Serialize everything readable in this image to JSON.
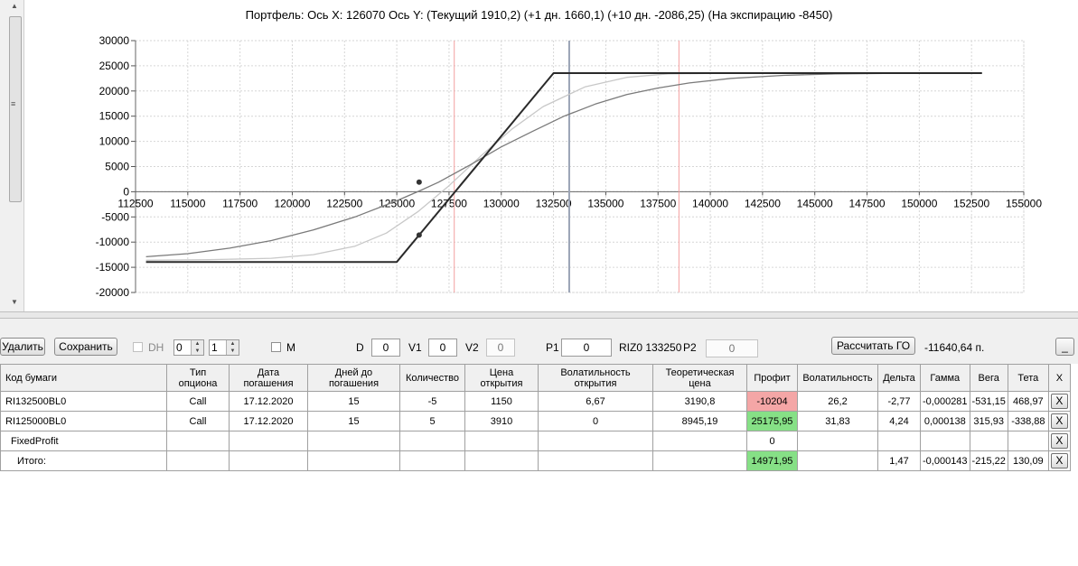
{
  "chart": {
    "title": "Портфель: Ось X:  126070 Ось Y:   (Текущий 1910,2)  (+1 дн. 1660,1)  (+10 дн. -2086,25)  (На экспирацию -8450)"
  },
  "chart_data": {
    "type": "line",
    "xlim": [
      112500,
      155000
    ],
    "ylim": [
      -20000,
      30000
    ],
    "x_ticks": [
      "112500",
      "115000",
      "117500",
      "120000",
      "122500",
      "125000",
      "127500",
      "130000",
      "132500",
      "135000",
      "137500",
      "140000",
      "142500",
      "145000",
      "147500",
      "150000",
      "152500",
      "155000"
    ],
    "y_ticks": [
      "30000",
      "25000",
      "20000",
      "15000",
      "10000",
      "5000",
      "0",
      "-5000",
      "-10000",
      "-15000",
      "-20000"
    ],
    "grid": true,
    "vertical_markers": [
      {
        "x": 127750,
        "color": "#f4a0a0"
      },
      {
        "x": 133250,
        "color": "#9aa3b5"
      },
      {
        "x": 138500,
        "color": "#f4a0a0"
      }
    ],
    "series": [
      {
        "color": "#2a2a2a",
        "points": [
          [
            113000,
            -13950
          ],
          [
            125000,
            -13950
          ],
          [
            132500,
            23550
          ],
          [
            153000,
            23550
          ]
        ],
        "marker": [
          126070,
          -8600
        ]
      },
      {
        "color": "#c8c8c8",
        "points": [
          [
            113000,
            -13600
          ],
          [
            116000,
            -13500
          ],
          [
            119000,
            -13200
          ],
          [
            121000,
            -12500
          ],
          [
            123000,
            -10800
          ],
          [
            124500,
            -8200
          ],
          [
            126000,
            -4000
          ],
          [
            127500,
            1200
          ],
          [
            129000,
            7000
          ],
          [
            130500,
            12400
          ],
          [
            132000,
            16900
          ],
          [
            134000,
            20800
          ],
          [
            136000,
            22700
          ],
          [
            138000,
            23400
          ],
          [
            141000,
            23550
          ],
          [
            153000,
            23550
          ]
        ]
      },
      {
        "color": "#7a7a7a",
        "points": [
          [
            113000,
            -12900
          ],
          [
            115000,
            -12300
          ],
          [
            117000,
            -11200
          ],
          [
            119000,
            -9700
          ],
          [
            121000,
            -7600
          ],
          [
            123000,
            -5000
          ],
          [
            125000,
            -1800
          ],
          [
            126070,
            150
          ],
          [
            127000,
            1900
          ],
          [
            128500,
            5300
          ],
          [
            130000,
            8900
          ],
          [
            131500,
            12000
          ],
          [
            133000,
            15000
          ],
          [
            134500,
            17400
          ],
          [
            136000,
            19300
          ],
          [
            137500,
            20600
          ],
          [
            139000,
            21600
          ],
          [
            141000,
            22500
          ],
          [
            143500,
            23100
          ],
          [
            146000,
            23400
          ],
          [
            150000,
            23550
          ],
          [
            153000,
            23550
          ]
        ],
        "marker": [
          126070,
          1910
        ]
      }
    ]
  },
  "toolbar": {
    "delete_label": "Удалить",
    "save_label": "Сохранить",
    "dh_label": "DH",
    "spin1_value": "0",
    "spin2_value": "1",
    "m_label": "M",
    "d_label": "D",
    "d_value": "0",
    "v1_label": "V1",
    "v1_value": "0",
    "v2_label": "V2",
    "v2_value": "0",
    "p1_label": "P1",
    "p1_value": "0",
    "instrument": "RIZ0 133250",
    "p2_label": "P2",
    "p2_value": "0",
    "calc_go_label": "Рассчитать ГО",
    "go_value": "-11640,64 п.",
    "minimize_label": "_"
  },
  "table": {
    "headers": [
      "Код бумаги",
      "Тип опциона",
      "Дата погашения",
      "Дней до погашения",
      "Количество",
      "Цена открытия",
      "Волатильность открытия",
      "Теоретическая цена",
      "Профит",
      "Волатильность",
      "Дельта",
      "Гамма",
      "Вега",
      "Тета",
      "X"
    ],
    "rows": [
      [
        "RI132500BL0",
        "Call",
        "17.12.2020",
        "15",
        "-5",
        "1150",
        "6,67",
        "3190,8",
        "-10204",
        "26,2",
        "-2,77",
        "-0,000281",
        "-531,15",
        "468,97",
        "X"
      ],
      [
        "RI125000BL0",
        "Call",
        "17.12.2020",
        "15",
        "5",
        "3910",
        "0",
        "8945,19",
        "25175,95",
        "31,83",
        "4,24",
        "0,000138",
        "315,93",
        "-338,88",
        "X"
      ],
      [
        "FixedProfit",
        "",
        "",
        "",
        "",
        "",
        "",
        "",
        "0",
        "",
        "",
        "",
        "",
        "",
        "X"
      ],
      [
        "Итого:",
        "",
        "",
        "",
        "",
        "",
        "",
        "",
        "14971,95",
        "",
        "1,47",
        "-0,000143",
        "-215,22",
        "130,09",
        "X"
      ]
    ]
  }
}
